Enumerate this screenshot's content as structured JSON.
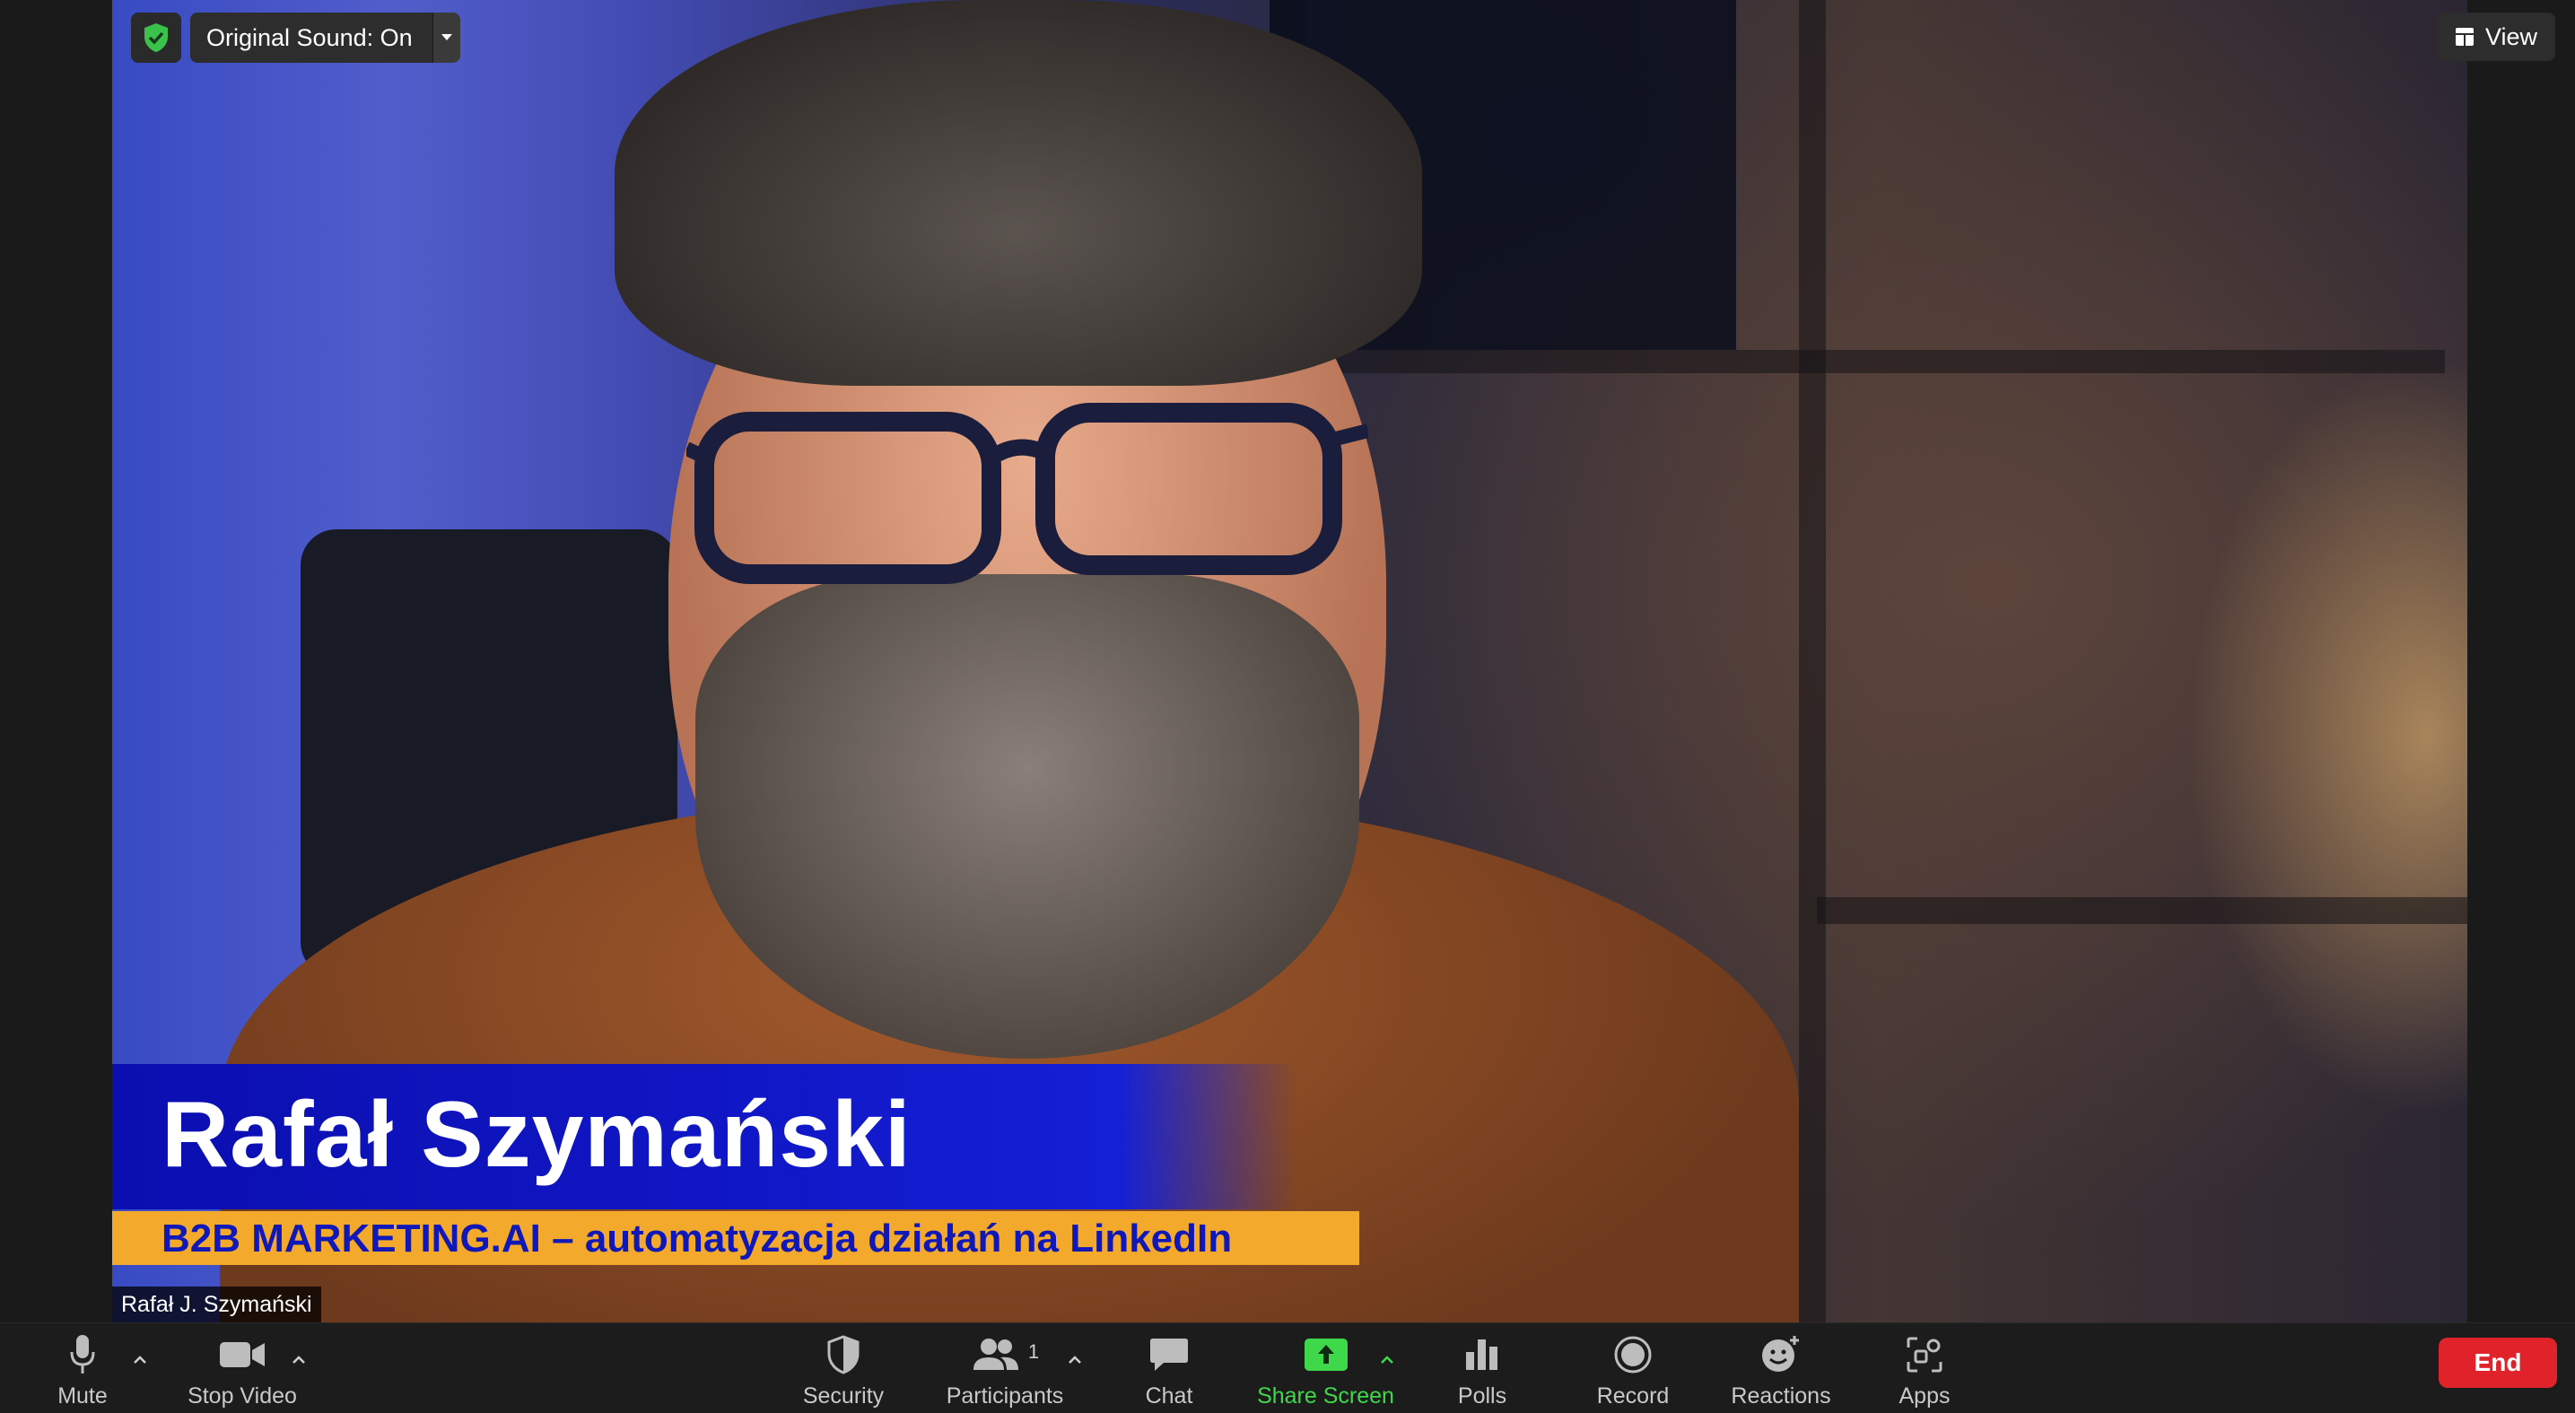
{
  "window": {
    "original_sound_label": "Original Sound: On",
    "view_label": "View"
  },
  "video": {
    "lower_third_name": "Rafał Szymański",
    "lower_third_subtitle": "B2B MARKETING.AI – automatyzacja działań na LinkedIn",
    "participant_name_tag": "Rafał J. Szymański"
  },
  "toolbar": {
    "mute_label": "Mute",
    "stop_video_label": "Stop Video",
    "security_label": "Security",
    "participants_label": "Participants",
    "participants_count": "1",
    "chat_label": "Chat",
    "share_screen_label": "Share Screen",
    "polls_label": "Polls",
    "record_label": "Record",
    "reactions_label": "Reactions",
    "apps_label": "Apps",
    "end_label": "End"
  },
  "colors": {
    "end_button": "#e0232b",
    "share_screen_accent": "#3fd84a",
    "lower_third_blue": "#1016c4",
    "lower_third_orange": "#f3a92b",
    "shield_green": "#3ac24b"
  },
  "icons": [
    "shield-check-icon",
    "chevron-down-icon",
    "view-grid-icon",
    "microphone-icon",
    "caret-up-icon",
    "video-camera-icon",
    "security-shield-icon",
    "participants-icon",
    "chat-bubble-icon",
    "share-screen-arrow-icon",
    "polls-bars-icon",
    "record-circle-icon",
    "reactions-smiley-icon",
    "apps-icon"
  ]
}
